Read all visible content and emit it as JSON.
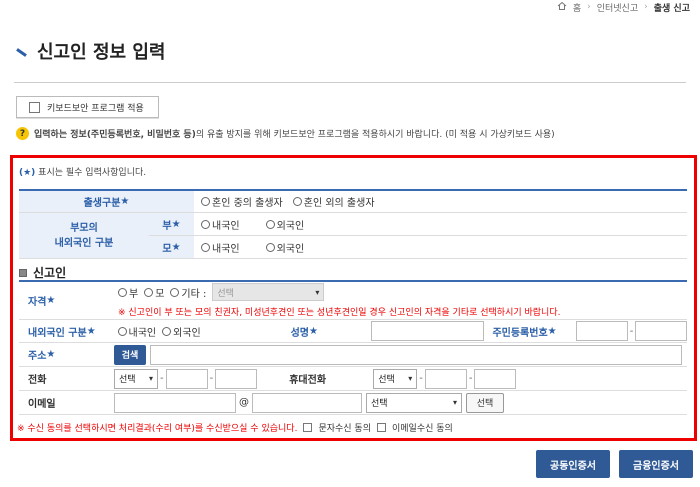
{
  "breadcrumb": {
    "home": "홈",
    "level1": "인터넷신고",
    "current": "출생 신고"
  },
  "page_title": "신고인 정보 입력",
  "keyboard_security": {
    "label": "키보드보안 프로그램 적용"
  },
  "notice": {
    "bold": "입력하는 정보(주민등록번호, 비밀번호 등)",
    "rest": "의 유출 방지를 위해 키보드보안 프로그램을 적용하시기 바랍니다. (미 적용 시 가상키보드 사용)"
  },
  "required_note": {
    "marker": "(★)",
    "text": "표시는 필수 입력사항입니다."
  },
  "birth_section": {
    "birth_type_label": "출생구분",
    "birth_type_options": [
      "혼인 중의 출생자",
      "혼인 외의 출생자"
    ],
    "parents_label": "부모의\n내외국인 구분",
    "father_label": "부",
    "mother_label": "모",
    "nationality_options": [
      "내국인",
      "외국인"
    ]
  },
  "reporter_section": {
    "title": "신고인",
    "qualification_label": "자격",
    "qualification_options": [
      "부",
      "모",
      "기타 :"
    ],
    "qualification_select": "선택",
    "qualification_note": "※ 신고인이 부 또는 모의 친권자, 미성년후견인 또는 성년후견인일 경우 신고인의 자격을 기타로 선택하시기 바랍니다.",
    "nationality_label": "내외국인 구분",
    "nationality_options": [
      "내국인",
      "외국인"
    ],
    "name_label": "성명",
    "rrn_label": "주민등록번호",
    "address_label": "주소",
    "search_button": "검색",
    "phone_label": "전화",
    "phone_select": "선택",
    "mobile_label": "휴대전화",
    "mobile_select": "선택",
    "email_label": "이메일",
    "email_at": "@",
    "email_select": "선택",
    "email_select_button": "선택"
  },
  "consent": {
    "text": "※ 수신 동의를 선택하시면 처리결과(수리 여부)를 수신받으실 수 있습니다.",
    "sms_label": "문자수신 동의",
    "email_label": "이메일수신 동의"
  },
  "buttons": {
    "joint_cert": "공동인증서",
    "financial_cert": "금융인증서"
  },
  "colors": {
    "accent": "#2b5fa8",
    "highlight_border": "#e00000",
    "button": "#2f5a96"
  }
}
